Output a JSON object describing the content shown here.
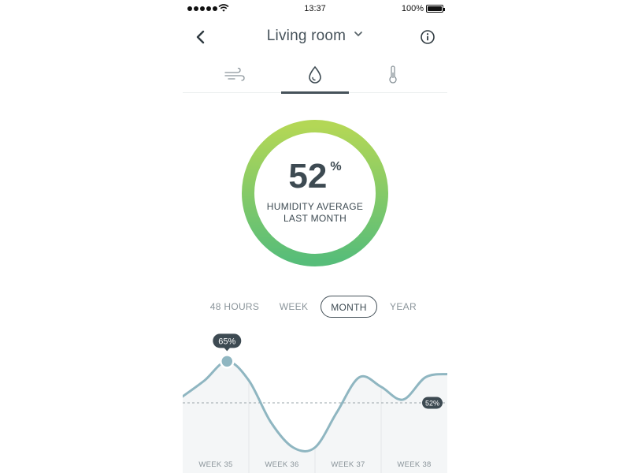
{
  "status_bar": {
    "time": "13:37",
    "battery": "100%",
    "battery_level": 1.0
  },
  "header": {
    "title": "Living room",
    "icons": [
      "back-icon",
      "chevron-down-icon",
      "info-icon"
    ]
  },
  "tabs": [
    {
      "name": "air",
      "icon": "wind-icon",
      "active": false
    },
    {
      "name": "humidity",
      "icon": "drop-icon",
      "active": true
    },
    {
      "name": "temperature",
      "icon": "thermometer-icon",
      "active": false
    }
  ],
  "gauge": {
    "value": "52",
    "unit": "%",
    "label_line1": "HUMIDITY AVERAGE",
    "label_line2": "LAST MONTH",
    "colors": [
      "#b3d756",
      "#57bd79"
    ]
  },
  "ranges": {
    "items": [
      "48 HOURS",
      "WEEK",
      "MONTH",
      "YEAR"
    ],
    "selected": "MONTH"
  },
  "chart_data": {
    "type": "line",
    "categories": [
      "WEEK 35",
      "WEEK 36",
      "WEEK 37",
      "WEEK 38"
    ],
    "x": [
      0,
      0.33,
      0.67,
      1,
      1.33,
      1.67,
      2,
      2.33,
      2.67,
      3,
      3.33,
      3.67,
      4
    ],
    "series": [
      {
        "values": [
          54,
          59,
          65,
          59,
          46,
          38,
          38,
          49,
          60,
          57,
          53,
          60,
          61
        ]
      }
    ],
    "reference_line": 52,
    "reference_label": "52%",
    "peak_label": "65%",
    "ylim": [
      30,
      72
    ],
    "line_color": "#8fb6c1"
  }
}
